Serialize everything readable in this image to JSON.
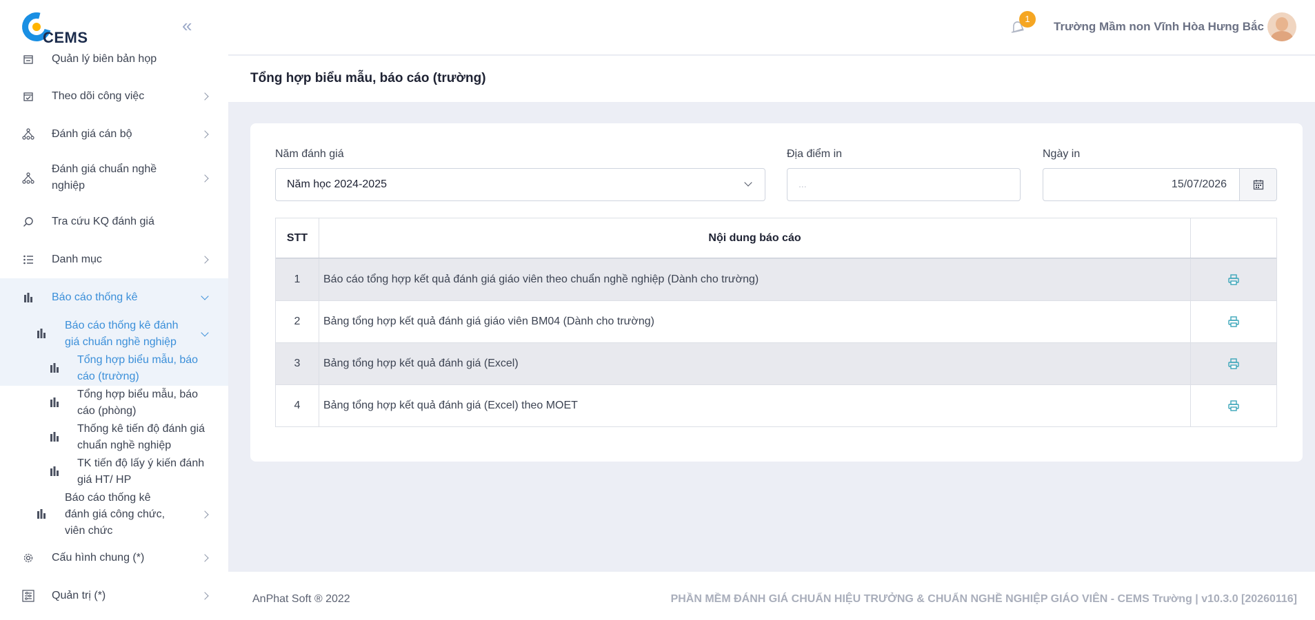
{
  "app": {
    "logo_text": "CEMS"
  },
  "sidebar": {
    "items": [
      {
        "label": "Quản lý biên bản họp",
        "icon": "meeting-icon"
      },
      {
        "label": "Theo dõi công việc",
        "icon": "task-check-icon"
      },
      {
        "label": "Đánh giá cán bộ",
        "icon": "org-chart-icon"
      },
      {
        "label": "Đánh giá chuẩn nghề nghiệp",
        "icon": "org-chart-icon"
      },
      {
        "label": "Tra cứu KQ đánh giá",
        "icon": "search-icon"
      },
      {
        "label": "Danh mục",
        "icon": "list-icon"
      },
      {
        "label": "Báo cáo thống kê",
        "icon": "bar-chart-icon"
      },
      {
        "label": "Báo cáo thống kê đánh giá chuẩn nghề nghiệp",
        "icon": "bar-chart-icon"
      },
      {
        "label": "Tổng hợp biểu mẫu, báo cáo (trường)",
        "icon": "bar-chart-icon"
      },
      {
        "label": "Tổng hợp biểu mẫu, báo cáo (phòng)",
        "icon": "bar-chart-icon"
      },
      {
        "label": "Thống kê tiến độ đánh giá chuẩn nghề nghiệp",
        "icon": "bar-chart-icon"
      },
      {
        "label": "TK tiến độ lấy ý kiến đánh giá HT/ HP",
        "icon": "bar-chart-icon"
      },
      {
        "label": "Báo cáo thống kê đánh giá công chức, viên chức",
        "icon": "bar-chart-icon"
      },
      {
        "label": "Cấu hình chung (*)",
        "icon": "gear-icon"
      },
      {
        "label": "Quản trị (*)",
        "icon": "sliders-icon"
      }
    ],
    "accent_color": "#3b8fd9"
  },
  "header": {
    "notification_count": "1",
    "school_name": "Trường Mầm non Vĩnh Hòa Hưng Bắc"
  },
  "page": {
    "title": "Tổng hợp biểu mẫu, báo cáo (trường)"
  },
  "filters": {
    "year_label": "Năm đánh giá",
    "year_value": "Năm học 2024-2025",
    "location_label": "Địa điểm in",
    "location_placeholder": "...",
    "date_label": "Ngày in",
    "date_value": "15/07/2026"
  },
  "table": {
    "headers": [
      "STT",
      "Nội dung báo cáo",
      ""
    ],
    "rows": [
      {
        "stt": "1",
        "content": "Báo cáo tổng hợp kết quả đánh giá giáo viên theo chuẩn nghề nghiệp (Dành cho trường)"
      },
      {
        "stt": "2",
        "content": "Bảng tổng hợp kết quả đánh giá giáo viên BM04 (Dành cho trường)"
      },
      {
        "stt": "3",
        "content": "Bảng tổng hợp kết quả đánh giá (Excel)"
      },
      {
        "stt": "4",
        "content": "Bảng tổng hợp kết quả đánh giá (Excel) theo MOET"
      }
    ]
  },
  "footer": {
    "left": "AnPhat Soft ® 2022",
    "right": "PHẦN MỀM ĐÁNH GIÁ CHUẨN HIỆU TRƯỞNG & CHUẨN NGHỀ NGHIỆP GIÁO VIÊN - CEMS Trường | v10.3.0 [20260116]"
  }
}
